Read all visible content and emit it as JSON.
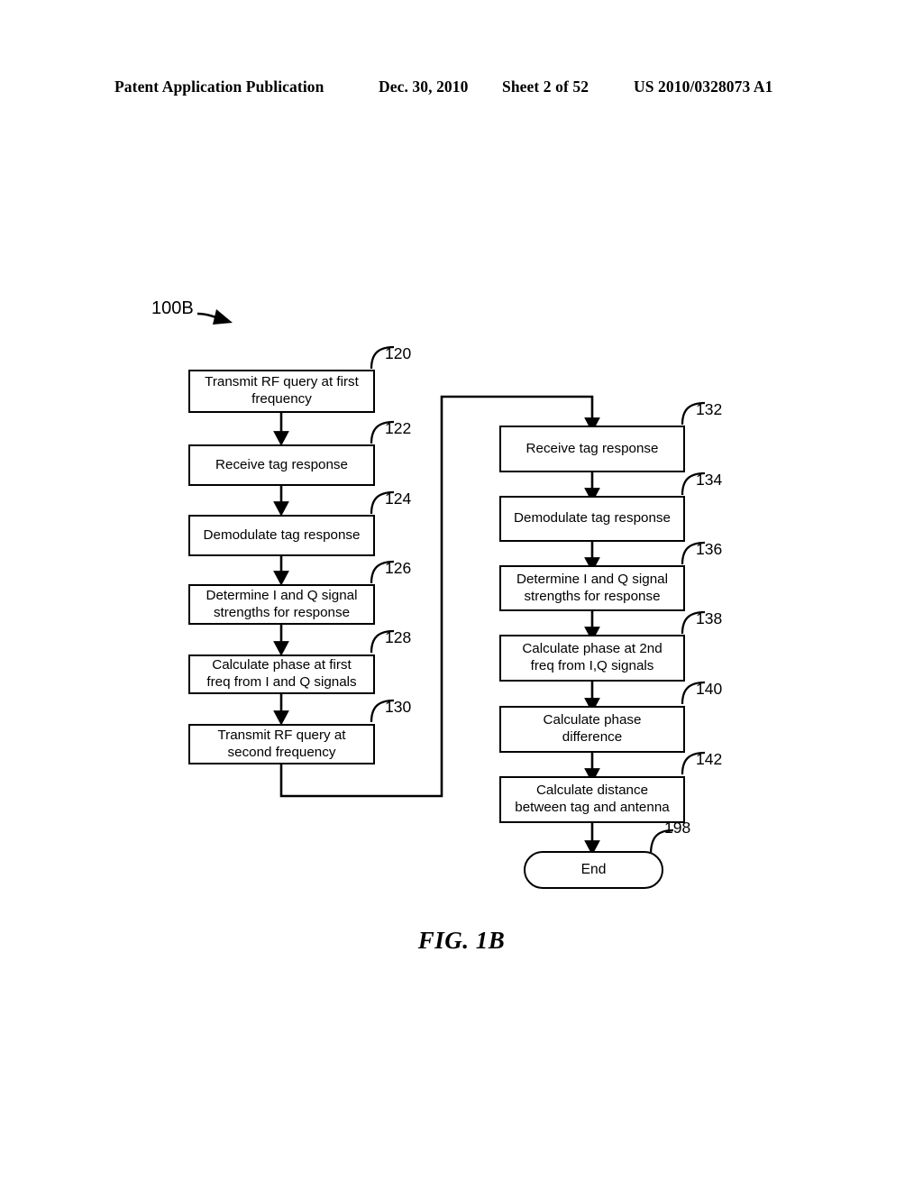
{
  "page": {
    "background_color": "#ffffff",
    "ink_color": "#000000"
  },
  "header": {
    "publication": "Patent Application Publication",
    "date": "Dec. 30, 2010",
    "sheet": "Sheet 2 of 52",
    "patent_number": "US 2010/0328073 A1"
  },
  "figure": {
    "caption": "FIG. 1B",
    "diagram_label": "100B"
  },
  "chart_data": {
    "type": "flowchart",
    "title": "FIG. 1B",
    "diagram_id": "100B",
    "columns": 2,
    "nodes": [
      {
        "ref": "120",
        "shape": "process",
        "column": "left",
        "order": 1,
        "text": "Transmit RF query at first frequency",
        "lines": [
          "Transmit RF query at first",
          "frequency"
        ]
      },
      {
        "ref": "122",
        "shape": "process",
        "column": "left",
        "order": 2,
        "text": "Receive tag response",
        "lines": [
          "Receive tag response"
        ]
      },
      {
        "ref": "124",
        "shape": "process",
        "column": "left",
        "order": 3,
        "text": "Demodulate tag response",
        "lines": [
          "Demodulate tag response"
        ]
      },
      {
        "ref": "126",
        "shape": "process",
        "column": "left",
        "order": 4,
        "text": "Determine I and Q signal strengths for response",
        "lines": [
          "Determine I and Q signal",
          "strengths for response"
        ]
      },
      {
        "ref": "128",
        "shape": "process",
        "column": "left",
        "order": 5,
        "text": "Calculate phase at first freq from I and Q signals",
        "lines": [
          "Calculate phase at first",
          "freq from I and Q signals"
        ]
      },
      {
        "ref": "130",
        "shape": "process",
        "column": "left",
        "order": 6,
        "text": "Transmit RF query at second frequency",
        "lines": [
          "Transmit RF query at",
          "second frequency"
        ]
      },
      {
        "ref": "132",
        "shape": "process",
        "column": "right",
        "order": 1,
        "text": "Receive tag response",
        "lines": [
          "Receive tag response"
        ]
      },
      {
        "ref": "134",
        "shape": "process",
        "column": "right",
        "order": 2,
        "text": "Demodulate tag response",
        "lines": [
          "Demodulate tag response"
        ]
      },
      {
        "ref": "136",
        "shape": "process",
        "column": "right",
        "order": 3,
        "text": "Determine I and Q signal strengths for response",
        "lines": [
          "Determine I and Q signal",
          "strengths for response"
        ]
      },
      {
        "ref": "138",
        "shape": "process",
        "column": "right",
        "order": 4,
        "text": "Calculate phase at 2nd freq from I,Q signals",
        "lines": [
          "Calculate phase at 2nd",
          "freq from I,Q signals"
        ]
      },
      {
        "ref": "140",
        "shape": "process",
        "column": "right",
        "order": 5,
        "text": "Calculate phase difference",
        "lines": [
          "Calculate phase",
          "difference"
        ]
      },
      {
        "ref": "142",
        "shape": "process",
        "column": "right",
        "order": 6,
        "text": "Calculate distance between tag and antenna",
        "lines": [
          "Calculate distance",
          "between tag and antenna"
        ]
      },
      {
        "ref": "198",
        "shape": "terminator",
        "column": "right",
        "order": 7,
        "text": "End",
        "lines": [
          "End"
        ]
      }
    ],
    "edges": [
      {
        "from": "120",
        "to": "122",
        "style": "straight-down-arrow"
      },
      {
        "from": "122",
        "to": "124",
        "style": "straight-down-arrow"
      },
      {
        "from": "124",
        "to": "126",
        "style": "straight-down-arrow"
      },
      {
        "from": "126",
        "to": "128",
        "style": "straight-down-arrow"
      },
      {
        "from": "128",
        "to": "130",
        "style": "straight-down-arrow"
      },
      {
        "from": "130",
        "to": "132",
        "style": "routed-down-right-up-right-down-arrow"
      },
      {
        "from": "132",
        "to": "134",
        "style": "straight-down-arrow"
      },
      {
        "from": "134",
        "to": "136",
        "style": "straight-down-arrow"
      },
      {
        "from": "136",
        "to": "138",
        "style": "straight-down-arrow"
      },
      {
        "from": "138",
        "to": "140",
        "style": "straight-down-arrow"
      },
      {
        "from": "140",
        "to": "142",
        "style": "straight-down-arrow"
      },
      {
        "from": "142",
        "to": "198",
        "style": "straight-down-arrow"
      }
    ]
  },
  "boxes": {
    "b120": {
      "ref": "120",
      "l1": "Transmit RF query at first",
      "l2": "frequency"
    },
    "b122": {
      "ref": "122",
      "l1": "Receive tag response",
      "l2": ""
    },
    "b124": {
      "ref": "124",
      "l1": "Demodulate tag response",
      "l2": ""
    },
    "b126": {
      "ref": "126",
      "l1": "Determine I and Q signal",
      "l2": "strengths for response"
    },
    "b128": {
      "ref": "128",
      "l1": "Calculate phase at first",
      "l2": "freq from I and Q signals"
    },
    "b130": {
      "ref": "130",
      "l1": "Transmit RF query at",
      "l2": "second frequency"
    },
    "b132": {
      "ref": "132",
      "l1": "Receive tag response",
      "l2": ""
    },
    "b134": {
      "ref": "134",
      "l1": "Demodulate tag response",
      "l2": ""
    },
    "b136": {
      "ref": "136",
      "l1": "Determine I and Q signal",
      "l2": "strengths for response"
    },
    "b138": {
      "ref": "138",
      "l1": "Calculate phase at 2nd",
      "l2": "freq from I,Q signals"
    },
    "b140": {
      "ref": "140",
      "l1": "Calculate phase",
      "l2": "difference"
    },
    "b142": {
      "ref": "142",
      "l1": "Calculate distance",
      "l2": "between tag and antenna"
    },
    "b198": {
      "ref": "198",
      "l1": "End",
      "l2": ""
    }
  }
}
